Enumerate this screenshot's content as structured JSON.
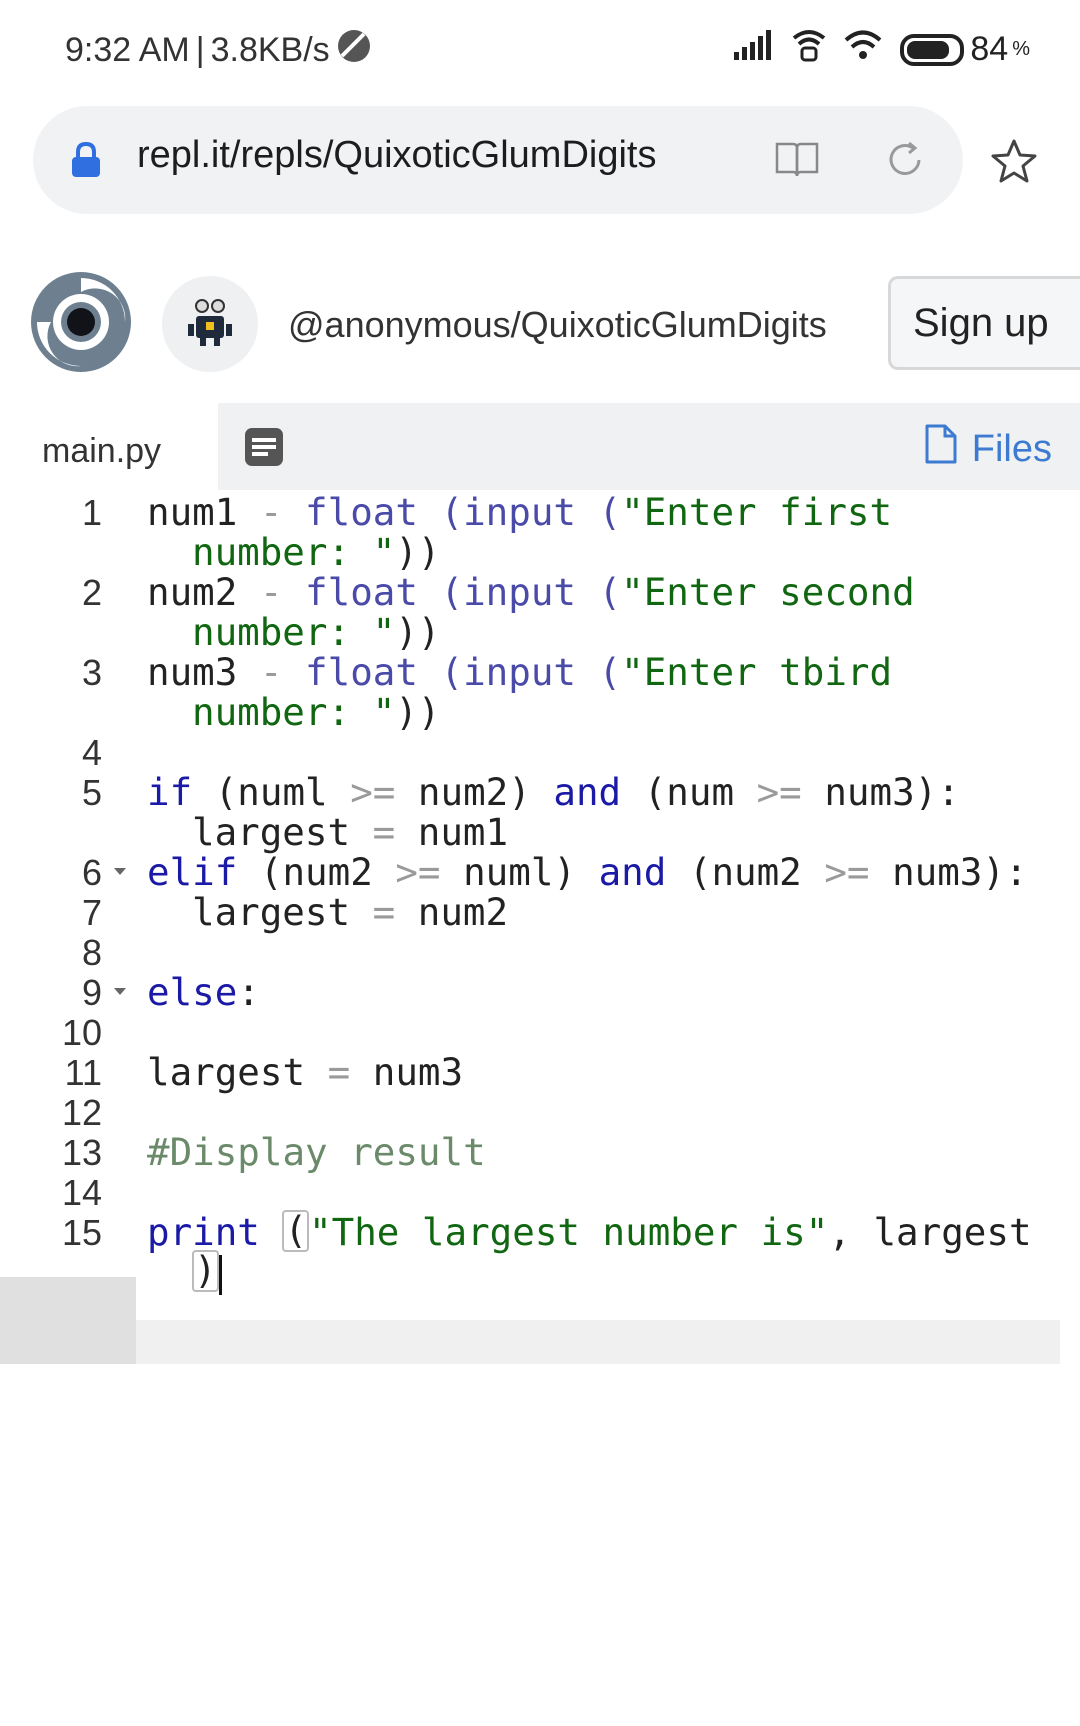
{
  "status_bar": {
    "time": "9:32 AM",
    "separator": "|",
    "speed": "3.8KB/s",
    "battery_level": "84",
    "battery_unit": "%",
    "icons": [
      "data-saver-icon",
      "signal-icon",
      "wifi-calling-icon",
      "wifi-icon",
      "battery-icon"
    ]
  },
  "browser": {
    "url": "repl.it/repls/QuixoticGlumDigits",
    "icons": [
      "lock-icon",
      "reader-mode-icon",
      "reload-icon",
      "bookmark-star-icon"
    ]
  },
  "repl_header": {
    "path": "@anonymous/QuixoticGlumDigits",
    "signup_label": "Sign up",
    "icons": [
      "replit-logo",
      "robot-avatar"
    ]
  },
  "tabs": {
    "file_name": "main.py",
    "files_label": "Files",
    "icons": [
      "console-icon",
      "file-icon"
    ]
  },
  "editor": {
    "language": "python",
    "active_line": 15,
    "fold_markers": [
      6,
      9
    ],
    "line_numbers": [
      "1",
      "2",
      "3",
      "4",
      "5",
      "6",
      "7",
      "8",
      "9",
      "10",
      "11",
      "12",
      "13",
      "14",
      "15"
    ],
    "lines": [
      {
        "n": "1",
        "text": "num1 - float (input (\"Enter first",
        "wrap": "number: \"))"
      },
      {
        "n": "2",
        "text": "num2 - float (input (\"Enter second",
        "wrap": "number: \"))"
      },
      {
        "n": "3",
        "text": "num3 - float (input (\"Enter tbird",
        "wrap": "number: \"))"
      },
      {
        "n": "4",
        "text": ""
      },
      {
        "n": "5",
        "text": "if (numl >= num2) and (num >= num3):",
        "wrap": "largest = num1"
      },
      {
        "n": "6",
        "text": "elif (num2 >= numl) and (num2 >= num3):"
      },
      {
        "n": "7",
        "text": "largest = num2"
      },
      {
        "n": "8",
        "text": ""
      },
      {
        "n": "9",
        "text": "else:"
      },
      {
        "n": "10",
        "text": ""
      },
      {
        "n": "11",
        "text": "largest = num3"
      },
      {
        "n": "12",
        "text": ""
      },
      {
        "n": "13",
        "text": "#Display result"
      },
      {
        "n": "14",
        "text": ""
      },
      {
        "n": "15",
        "text": "print (\"The largest number is\", largest",
        "wrap": ")"
      }
    ],
    "tokens": {
      "l1_a": "num1",
      "l1_b": "-",
      "l1_c": "float",
      "l1_d": "(input (",
      "l1_e": "\"Enter first",
      "l1_w": "number: \"",
      "l2_a": "num2",
      "l2_b": "-",
      "l2_c": "float",
      "l2_d": "(input (",
      "l2_e": "\"Enter second",
      "l2_w": "number: \"",
      "l3_a": "num3",
      "l3_b": "-",
      "l3_c": "float",
      "l3_d": "(input (",
      "l3_e": "\"Enter tbird",
      "l3_w": "number: \"",
      "close2": "))",
      "l5_if": "if",
      "l5_a": " (numl ",
      "ge": ">=",
      "l5_b": " num2) ",
      "and": "and",
      "l5_c": " (num ",
      "l5_d": " num3):",
      "l5_w_a": "largest ",
      "eq": "=",
      "l5_w_b": " num1",
      "l6_elif": "elif",
      "l6_a": " (num2 ",
      "l6_b": " numl) ",
      "l6_c": " (num2 ",
      "l6_d": " num3):",
      "l7_a": "largest ",
      "l7_b": " num2",
      "l9_else": "else",
      "colon": ":",
      "l11_a": "largest ",
      "l11_b": " num3",
      "l13": "#Display result",
      "l15_print": "print",
      "open_paren": "(",
      "l15_str": "\"The largest number is\"",
      "l15_rest": ", largest",
      "close_paren": ")"
    }
  },
  "colors": {
    "keyword": "#1a1aa6",
    "string": "#116611",
    "comment": "#6a8a6a",
    "link_blue": "#3c7bd1",
    "active_line_bg": "#f0f0f0"
  }
}
